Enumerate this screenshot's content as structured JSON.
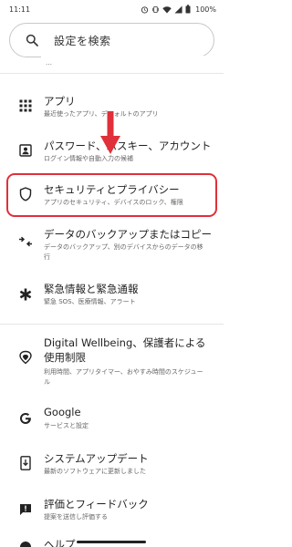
{
  "status_bar": {
    "time": "11:11",
    "battery_percent": "100%",
    "icons": [
      "alarm-icon",
      "vibrate-icon",
      "wifi-icon",
      "signal-icon",
      "battery-icon"
    ]
  },
  "search": {
    "placeholder": "設定を検索"
  },
  "partial_item": {
    "subtitle": "…"
  },
  "items": [
    {
      "icon": "grid-icon",
      "title": "アプリ",
      "subtitle": "最近使ったアプリ、デフォルトのアプリ"
    },
    {
      "icon": "account-box-icon",
      "title": "パスワード、パスキー、アカウント",
      "subtitle": "ログイン情報や自動入力の候補"
    },
    {
      "icon": "shield-icon",
      "title": "セキュリティとプライバシー",
      "subtitle": "アプリのセキュリティ、デバイスのロック、権限"
    },
    {
      "icon": "backup-icon",
      "title": "データのバックアップまたはコピー",
      "subtitle": "データのバックアップ、別のデバイスからのデータの移行"
    },
    {
      "icon": "asterisk-icon",
      "title": "緊急情報と緊急通報",
      "subtitle": "緊急 SOS、医療情報、アラート"
    },
    {
      "icon": "wellbeing-icon",
      "title": "Digital Wellbeing、保護者による使用制限",
      "subtitle": "利用時間、アプリタイマー、おやすみ時間のスケジュール"
    },
    {
      "icon": "google-icon",
      "title": "Google",
      "subtitle": "サービスと設定"
    },
    {
      "icon": "system-update-icon",
      "title": "システムアップデート",
      "subtitle": "最新のソフトウェアに更新しました"
    },
    {
      "icon": "feedback-icon",
      "title": "評価とフィードバック",
      "subtitle": "提案を送信し評価する"
    },
    {
      "icon": "help-icon",
      "title": "ヘルプ",
      "subtitle": ""
    }
  ],
  "highlight": {
    "target": "セキュリティとプライバシー",
    "color": "#e0303a"
  },
  "colors": {
    "accent_red": "#e0303a",
    "text": "#1f1f1f",
    "subtext": "#666666",
    "divider": "#e6e6e6"
  }
}
